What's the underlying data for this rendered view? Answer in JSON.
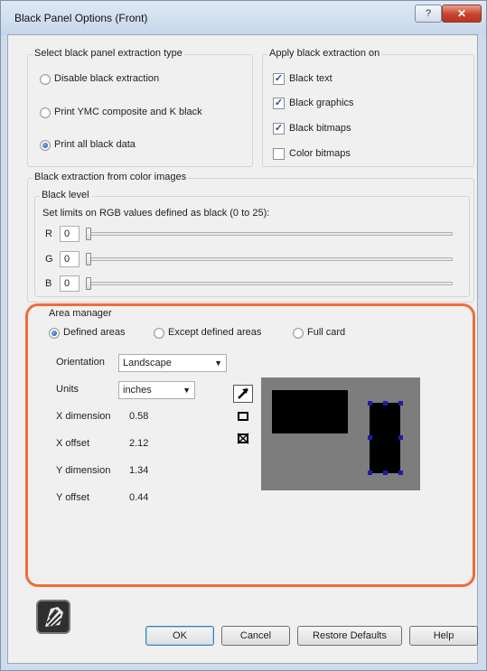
{
  "window": {
    "title": "Black Panel Options (Front)",
    "help_label": "?",
    "close_label": "✕"
  },
  "extraction_type": {
    "title": "Select black panel extraction type",
    "options": [
      {
        "label": "Disable black extraction",
        "selected": false
      },
      {
        "label": "Print YMC composite and K black",
        "selected": false
      },
      {
        "label": "Print all black data",
        "selected": true
      }
    ]
  },
  "apply_on": {
    "title": "Apply black extraction on",
    "options": [
      {
        "label": "Black text",
        "checked": true
      },
      {
        "label": "Black graphics",
        "checked": true
      },
      {
        "label": "Black bitmaps",
        "checked": true
      },
      {
        "label": "Color bitmaps",
        "checked": false
      }
    ]
  },
  "color_images": {
    "title": "Black extraction from color images",
    "black_level": {
      "title": "Black level",
      "instruction": "Set limits on RGB values defined as black (0 to 25):",
      "channels": [
        {
          "label": "R",
          "value": "0"
        },
        {
          "label": "G",
          "value": "0"
        },
        {
          "label": "B",
          "value": "0"
        }
      ]
    }
  },
  "area_manager": {
    "title": "Area manager",
    "modes": [
      {
        "label": "Defined areas",
        "selected": true
      },
      {
        "label": "Except defined areas",
        "selected": false
      },
      {
        "label": "Full card",
        "selected": false
      }
    ],
    "orientation": {
      "label": "Orientation",
      "value": "Landscape"
    },
    "units": {
      "label": "Units",
      "value": "inches"
    },
    "fields": [
      {
        "label": "X dimension",
        "value": "0.58"
      },
      {
        "label": "X offset",
        "value": "2.12"
      },
      {
        "label": "Y dimension",
        "value": "1.34"
      },
      {
        "label": "Y offset",
        "value": "0.44"
      }
    ],
    "tools": [
      "pointer-arrow-icon",
      "rectangle-icon",
      "delete-area-icon"
    ]
  },
  "buttons": {
    "ok": "OK",
    "cancel": "Cancel",
    "restore": "Restore Defaults",
    "help": "Help"
  },
  "colors": {
    "highlight": "#f26b3a",
    "preview_background": "#7d7d7d",
    "handle": "#1c1ca8"
  }
}
